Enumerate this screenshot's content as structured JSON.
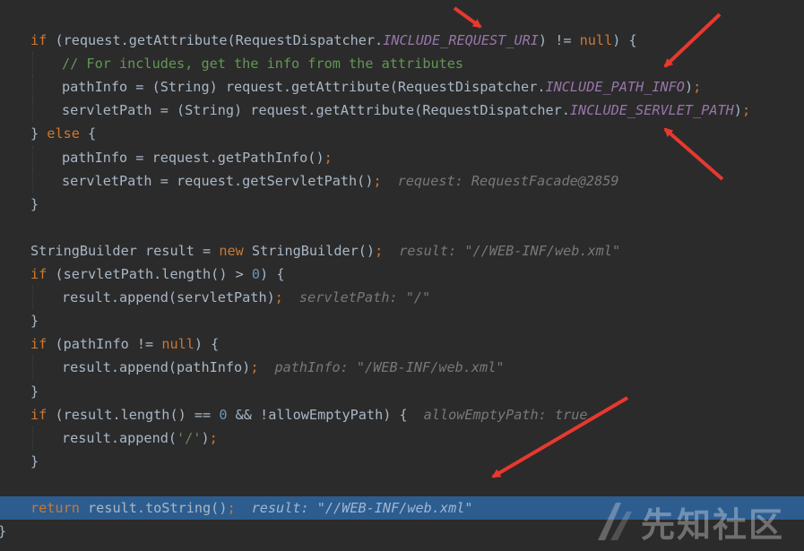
{
  "lines": [
    {
      "indent": 1,
      "tokens": [
        [
          "kw",
          "if"
        ],
        [
          "plain",
          " (request.getAttribute(RequestDispatcher."
        ],
        [
          "const",
          "INCLUDE_REQUEST_URI"
        ],
        [
          "plain",
          ") != "
        ],
        [
          "kw",
          "null"
        ],
        [
          "plain",
          ") {"
        ]
      ]
    },
    {
      "indent": 2,
      "tokens": [
        [
          "cm",
          "// For includes, get the info from the attributes"
        ]
      ]
    },
    {
      "indent": 2,
      "tokens": [
        [
          "plain",
          "pathInfo = (String) request.getAttribute(RequestDispatcher."
        ],
        [
          "const",
          "INCLUDE_PATH_INFO"
        ],
        [
          "plain",
          ")"
        ],
        [
          "kw",
          ";"
        ]
      ]
    },
    {
      "indent": 2,
      "tokens": [
        [
          "plain",
          "servletPath = (String) request.getAttribute(RequestDispatcher."
        ],
        [
          "const",
          "INCLUDE_SERVLET_PATH"
        ],
        [
          "plain",
          ")"
        ],
        [
          "kw",
          ";"
        ]
      ]
    },
    {
      "indent": 1,
      "tokens": [
        [
          "plain",
          "} "
        ],
        [
          "kw",
          "else"
        ],
        [
          "plain",
          " {"
        ]
      ]
    },
    {
      "indent": 2,
      "tokens": [
        [
          "plain",
          "pathInfo = request.getPathInfo()"
        ],
        [
          "kw",
          ";"
        ]
      ]
    },
    {
      "indent": 2,
      "tokens": [
        [
          "plain",
          "servletPath = request.getServletPath()"
        ],
        [
          "kw",
          ";"
        ],
        [
          "hint",
          "request: RequestFacade@2859"
        ]
      ]
    },
    {
      "indent": 1,
      "tokens": [
        [
          "plain",
          "}"
        ]
      ]
    },
    {
      "indent": 1,
      "tokens": []
    },
    {
      "indent": 1,
      "tokens": [
        [
          "plain",
          "StringBuilder result = "
        ],
        [
          "kw",
          "new"
        ],
        [
          "plain",
          " StringBuilder()"
        ],
        [
          "kw",
          ";"
        ],
        [
          "hint",
          "result: \"//WEB-INF/web.xml\""
        ]
      ]
    },
    {
      "indent": 1,
      "tokens": [
        [
          "kw",
          "if"
        ],
        [
          "plain",
          " (servletPath.length() > "
        ],
        [
          "num",
          "0"
        ],
        [
          "plain",
          ") {"
        ]
      ]
    },
    {
      "indent": 2,
      "tokens": [
        [
          "plain",
          "result.append(servletPath)"
        ],
        [
          "kw",
          ";"
        ],
        [
          "hint",
          "servletPath: \"/\""
        ]
      ]
    },
    {
      "indent": 1,
      "tokens": [
        [
          "plain",
          "}"
        ]
      ]
    },
    {
      "indent": 1,
      "tokens": [
        [
          "kw",
          "if"
        ],
        [
          "plain",
          " (pathInfo != "
        ],
        [
          "kw",
          "null"
        ],
        [
          "plain",
          ") {"
        ]
      ]
    },
    {
      "indent": 2,
      "tokens": [
        [
          "plain",
          "result.append(pathInfo)"
        ],
        [
          "kw",
          ";"
        ],
        [
          "hint",
          "pathInfo: \"/WEB-INF/web.xml\""
        ]
      ]
    },
    {
      "indent": 1,
      "tokens": [
        [
          "plain",
          "}"
        ]
      ]
    },
    {
      "indent": 1,
      "tokens": [
        [
          "kw",
          "if"
        ],
        [
          "plain",
          " (result.length() == "
        ],
        [
          "num",
          "0"
        ],
        [
          "plain",
          " && !allowEmptyPath) {"
        ],
        [
          "hint",
          "allowEmptyPath: true"
        ]
      ]
    },
    {
      "indent": 2,
      "tokens": [
        [
          "plain",
          "result.append("
        ],
        [
          "str",
          "'/'"
        ],
        [
          "plain",
          ")"
        ],
        [
          "kw",
          ";"
        ]
      ]
    },
    {
      "indent": 1,
      "tokens": [
        [
          "plain",
          "}"
        ]
      ]
    },
    {
      "indent": 1,
      "tokens": []
    },
    {
      "indent": 1,
      "current": true,
      "tokens": [
        [
          "kw",
          "return"
        ],
        [
          "plain",
          " result.toString()"
        ],
        [
          "kw",
          ";"
        ],
        [
          "hint",
          "result: \"//WEB-INF/web.xml\""
        ]
      ]
    },
    {
      "indent": 0,
      "tokens": [
        [
          "plain",
          "}"
        ]
      ]
    }
  ],
  "watermark": {
    "text": "先知社区",
    "logo_icon": "xianzhi-logo-icon"
  },
  "colors": {
    "background": "#2b2b2b",
    "current_line": "#2d5d8f",
    "keyword": "#cc7832",
    "constant": "#9876aa",
    "comment": "#629755",
    "number": "#6897bb",
    "string": "#6a8759",
    "inline_hint": "#787878",
    "annotation_arrow": "#e8382f"
  }
}
